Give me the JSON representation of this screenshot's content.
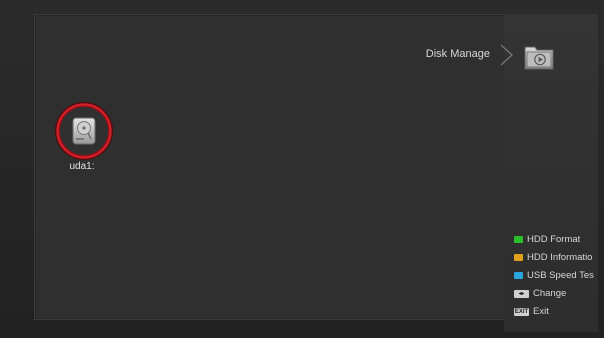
{
  "header": {
    "title": "Disk Manage",
    "icon": "media-folder-icon"
  },
  "disks": [
    {
      "label": "uda1:",
      "icon": "hard-disk-icon",
      "selected": true
    }
  ],
  "legend": {
    "hdd_format": {
      "label": "HDD Format",
      "color": "#2bbf2b"
    },
    "hdd_info": {
      "label": "HDD Informatio",
      "color": "#e1a11b"
    },
    "usb_speed": {
      "label": "USB Speed Tes",
      "color": "#2aa7dd"
    },
    "change": {
      "label": "Change",
      "key_label": "◂▸"
    },
    "exit": {
      "label": "Exit",
      "key_label": "EXIT"
    }
  },
  "colors": {
    "focus_ring": "#c0121b",
    "panel": "#2f2f2f",
    "text": "#d8d8d8"
  }
}
